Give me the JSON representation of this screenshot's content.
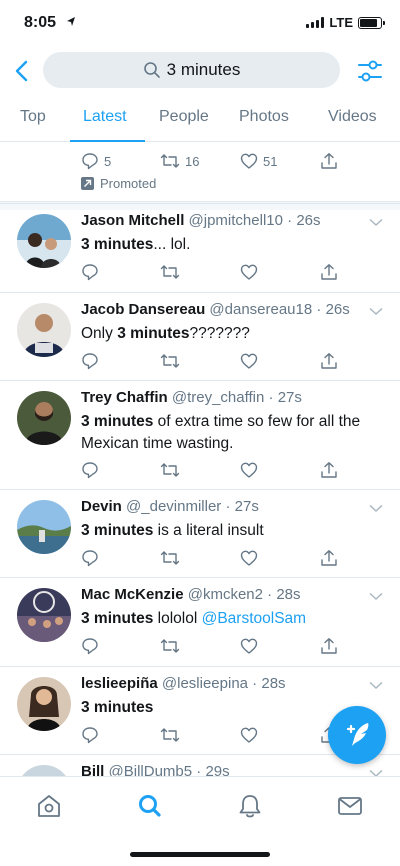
{
  "status_bar": {
    "time": "8:05",
    "network": "LTE",
    "battery_level": 0.85
  },
  "search": {
    "query": "3 minutes"
  },
  "tabs": [
    {
      "label": "Top",
      "active": false
    },
    {
      "label": "Latest",
      "active": true
    },
    {
      "label": "People",
      "active": false
    },
    {
      "label": "Photos",
      "active": false
    },
    {
      "label": "Videos",
      "active": false
    }
  ],
  "promoted": {
    "reply_count": "5",
    "retweet_count": "16",
    "like_count": "51",
    "label": "Promoted"
  },
  "tweets": [
    {
      "name": "Jason Mitchell",
      "handle": "@jpmitchell10",
      "time": "26s",
      "text_bold": "3 minutes",
      "text_rest": "... lol.",
      "text_prefix": ""
    },
    {
      "name": "Jacob Dansereau",
      "handle": "@dansereau18",
      "time": "26s",
      "text_prefix": "Only ",
      "text_bold": "3 minutes",
      "text_rest": "???????"
    },
    {
      "name": "Trey Chaffin",
      "handle": "@trey_chaffin",
      "time": "27s",
      "text_prefix": "",
      "text_bold": "3 minutes",
      "text_rest": " of extra time so few for all the Mexican time wasting."
    },
    {
      "name": "Devin",
      "handle": "@_devinmiller",
      "time": "27s",
      "text_prefix": "",
      "text_bold": "3 minutes",
      "text_rest": " is a literal insult"
    },
    {
      "name": "Mac McKenzie",
      "handle": "@kmcken2",
      "time": "28s",
      "text_prefix": "",
      "text_bold": "3 minutes",
      "text_rest": " lololol ",
      "mention": "@BarstoolSam"
    },
    {
      "name": "leslieepiña",
      "handle": "@leslieepina",
      "time": "28s",
      "text_prefix": "",
      "text_bold": "3 minutes",
      "text_rest": ""
    },
    {
      "name": "Bill",
      "handle": "@BillDumb5",
      "time": "29s"
    }
  ],
  "icons": {
    "back": "chevron-left-icon",
    "search": "search-icon",
    "filter": "sliders-icon",
    "reply": "reply-icon",
    "retweet": "retweet-icon",
    "like": "heart-icon",
    "share": "share-icon",
    "compose": "compose-tweet-icon",
    "nav": [
      "home-icon",
      "search-icon",
      "notifications-icon",
      "messages-icon"
    ]
  },
  "colors": {
    "accent": "#1da1f2",
    "text": "#14171a",
    "muted": "#657786",
    "search_bg": "#e6ecf0"
  }
}
